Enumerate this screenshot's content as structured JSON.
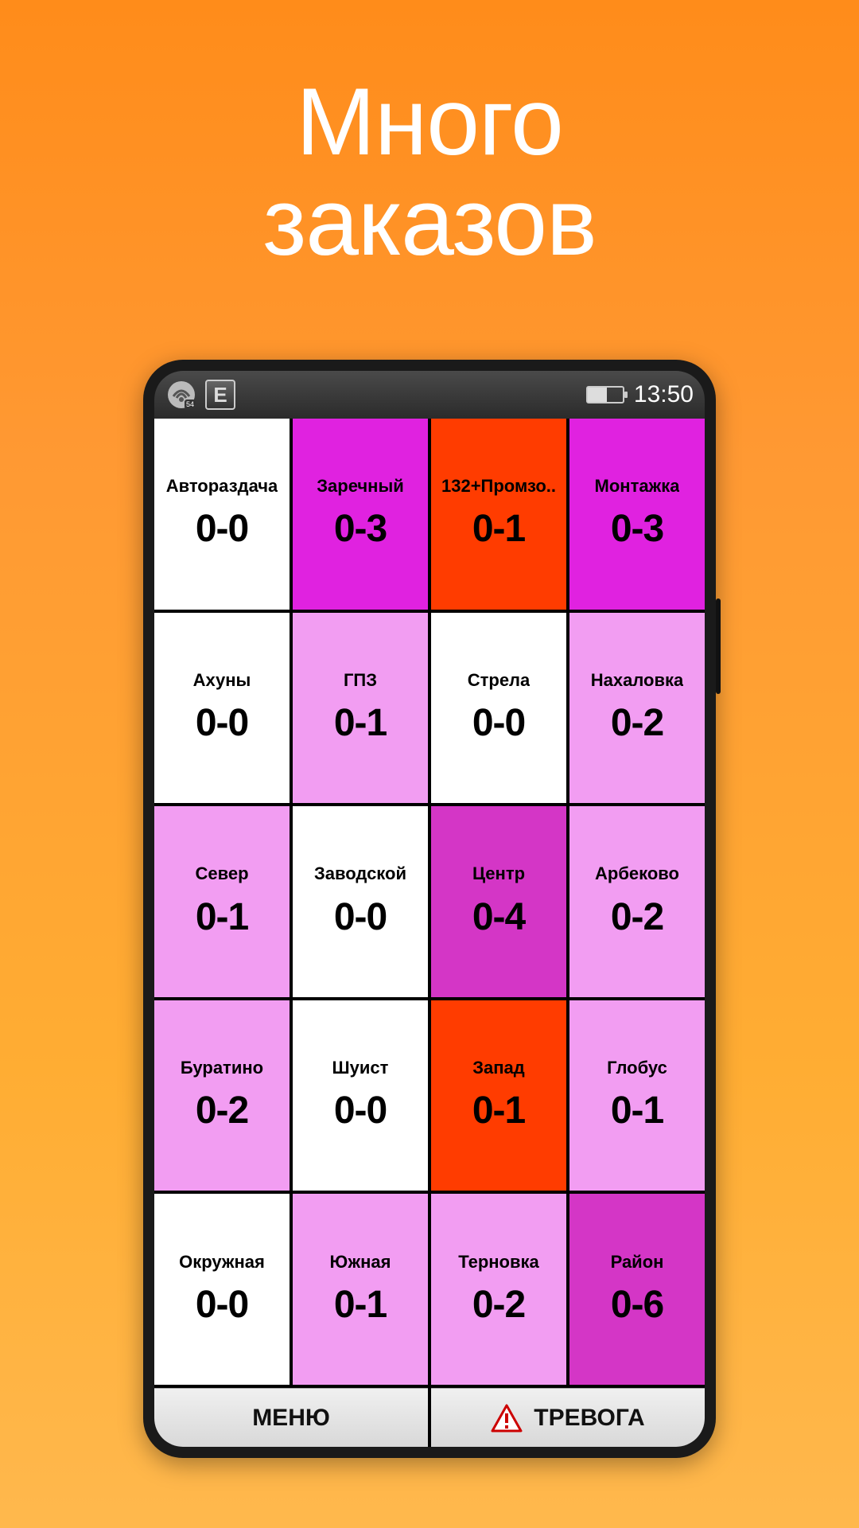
{
  "headline": "Много\nзаказов",
  "statusbar": {
    "badge_count": "54",
    "net_label": "E",
    "time": "13:50"
  },
  "grid": [
    {
      "label": "Автораздача",
      "value": "0-0",
      "style": "c-white"
    },
    {
      "label": "Заречный",
      "value": "0-3",
      "style": "c-magenta"
    },
    {
      "label": "132+Промзо..",
      "value": "0-1",
      "style": "c-orange"
    },
    {
      "label": "Монтажка",
      "value": "0-3",
      "style": "c-magenta"
    },
    {
      "label": "Ахуны",
      "value": "0-0",
      "style": "c-white"
    },
    {
      "label": "ГПЗ",
      "value": "0-1",
      "style": "c-pink"
    },
    {
      "label": "Стрела",
      "value": "0-0",
      "style": "c-white"
    },
    {
      "label": "Нахаловка",
      "value": "0-2",
      "style": "c-pink"
    },
    {
      "label": "Север",
      "value": "0-1",
      "style": "c-pink"
    },
    {
      "label": "Заводской",
      "value": "0-0",
      "style": "c-white"
    },
    {
      "label": "Центр",
      "value": "0-4",
      "style": "c-hotpink"
    },
    {
      "label": "Арбеково",
      "value": "0-2",
      "style": "c-pink"
    },
    {
      "label": "Буратино",
      "value": "0-2",
      "style": "c-pink"
    },
    {
      "label": "Шуист",
      "value": "0-0",
      "style": "c-white"
    },
    {
      "label": "Запад",
      "value": "0-1",
      "style": "c-orange"
    },
    {
      "label": "Глобус",
      "value": "0-1",
      "style": "c-pink"
    },
    {
      "label": "Окружная",
      "value": "0-0",
      "style": "c-white"
    },
    {
      "label": "Южная",
      "value": "0-1",
      "style": "c-pink"
    },
    {
      "label": "Терновка",
      "value": "0-2",
      "style": "c-pink"
    },
    {
      "label": "Район",
      "value": "0-6",
      "style": "c-hotpink"
    }
  ],
  "bottombar": {
    "menu_label": "МЕНЮ",
    "alarm_label": "ТРЕВОГА"
  }
}
